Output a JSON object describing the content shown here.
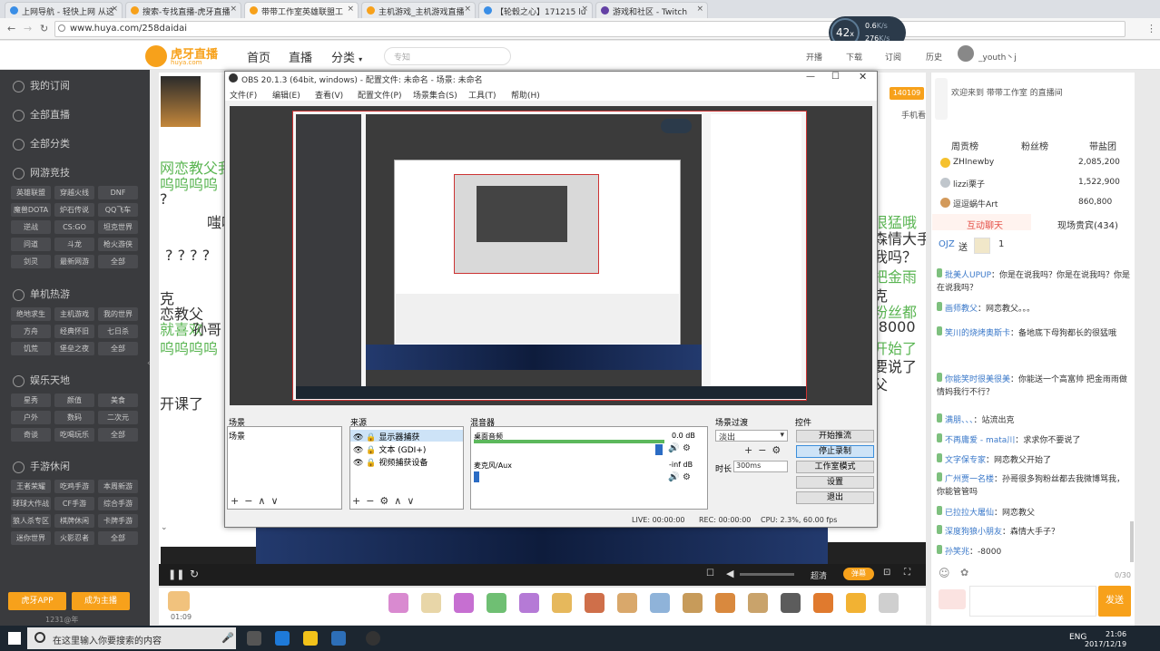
{
  "browser": {
    "tabs": [
      {
        "label": "上网导航 - 轻快上网 从这",
        "color": "#3a8ee6"
      },
      {
        "label": "搜索-专找直播-虎牙直播",
        "color": "#f7a11b"
      },
      {
        "label": "带带工作室英雄联盟工",
        "color": "#f7a11b"
      },
      {
        "label": "主机游戏_主机游戏直播",
        "color": "#f7a11b"
      },
      {
        "label": "【轮毂之心】171215 lu",
        "color": "#3a8ee6"
      },
      {
        "label": "游戏和社区 - Twitch",
        "color": "#6441a5"
      }
    ],
    "url": "www.huya.com/258daidai"
  },
  "perf": {
    "value": "42",
    "unit": "x",
    "up": "0.6",
    "up_unit": "K/s",
    "down": "276",
    "down_unit": "K/s"
  },
  "huya": {
    "logo_main": "虎牙直播",
    "logo_sub": "huya.com",
    "nav": [
      "首页",
      "直播",
      "分类"
    ],
    "search_placeholder": "专知",
    "header_icons": [
      "开播",
      "下载",
      "订阅",
      "历史"
    ],
    "username": "_youth丶j"
  },
  "sidebar": {
    "sections": [
      {
        "title": "我的订阅"
      },
      {
        "title": "全部直播"
      },
      {
        "title": "全部分类"
      },
      {
        "title": "网游竞技",
        "tags": [
          "英雄联盟",
          "穿越火线",
          "DNF",
          "魔兽DOTA",
          "炉石传说",
          "QQ飞车",
          "逆战",
          "CS:GO",
          "坦克世界",
          "问道",
          "斗龙",
          "枪火游侠",
          "剑灵",
          "最新网游",
          "全部"
        ]
      },
      {
        "title": "单机热游",
        "tags": [
          "绝地求生",
          "主机游戏",
          "我的世界",
          "方舟",
          "经典怀旧",
          "七日杀",
          "饥荒",
          "堡垒之夜",
          "全部"
        ]
      },
      {
        "title": "娱乐天地",
        "tags": [
          "星秀",
          "颜值",
          "美食",
          "户外",
          "数码",
          "二次元",
          "奇谈",
          "吃喝玩乐",
          "全部"
        ]
      },
      {
        "title": "手游休闲",
        "tags": [
          "王者荣耀",
          "吃鸡手游",
          "本周新游",
          "球球大作战",
          "CF手游",
          "综合手游",
          "狼人杀专区",
          "棋牌休闲",
          "卡牌手游",
          "迷你世界",
          "火影忍者",
          "全部"
        ]
      }
    ],
    "app_button": "虎牙APP",
    "host_button": "成为主播",
    "year_text": "1231@年"
  },
  "room": {
    "fans_count": "140109",
    "subscribe_label": "订阅",
    "phone_label": "手机看",
    "time": "01:09",
    "quality": "超清",
    "mode": "弹幕"
  },
  "danmu_lines": [
    "网恋教父我",
    "呜呜呜呜",
    "?",
    "嗤嗤",
    "? ? ? ?",
    "克",
    "恋教父",
    "就喜欢",
    "孙哥",
    "呜呜呜呜",
    "开课了",
    "很猛哦",
    "森情大手",
    "我吗？",
    "把金雨",
    "克",
    "粉丝都",
    "-8000",
    "开始了",
    "要说了",
    "父"
  ],
  "obs": {
    "title": "OBS 20.1.3 (64bit, windows) - 配置文件: 未命名 - 场景: 未命名",
    "menu": [
      "文件(F)",
      "编辑(E)",
      "查看(V)",
      "配置文件(P)",
      "场景集合(S)",
      "工具(T)",
      "帮助(H)"
    ],
    "docks": {
      "scenes": {
        "title": "场景",
        "items": [
          "场景"
        ]
      },
      "sources": {
        "title": "来源",
        "items": [
          "显示器捕获",
          "文本 (GDI+)",
          "视频捕获设备"
        ]
      },
      "mixer": {
        "title": "混音器",
        "channels": [
          {
            "name": "桌面音频",
            "db": "0.0 dB"
          },
          {
            "name": "麦克风/Aux",
            "db": "-inf dB"
          }
        ]
      },
      "transitions": {
        "title": "场景过渡",
        "selected": "淡出",
        "duration_label": "时长",
        "duration": "300ms"
      },
      "controls": {
        "title": "控件",
        "buttons": [
          "开始推流",
          "停止录制",
          "工作室模式",
          "设置",
          "退出"
        ]
      }
    },
    "status": {
      "live": "LIVE: 00:00:00",
      "rec": "REC: 00:00:00",
      "cpu": "CPU: 2.3%, 60.00 fps"
    }
  },
  "chat": {
    "welcome": "欢迎来到 带带工作室 的直播间",
    "tabs": [
      "周贡榜",
      "粉丝榜",
      "带盐团"
    ],
    "ranks": [
      {
        "name": "ZHInewby",
        "value": "2,085,200"
      },
      {
        "name": "lizzi栗子",
        "value": "1,522,900"
      },
      {
        "name": "逗逗蜗牛Art",
        "value": "860,800"
      }
    ],
    "sub_tabs": [
      "互动聊天",
      "现场贵宾(434)"
    ],
    "gift_line": {
      "name": "OJZ",
      "action": "送",
      "count": "1"
    },
    "messages": [
      {
        "name": "批美人UPUP",
        "text": "你是在说我吗？你是在说我吗？你是在说我吗？"
      },
      {
        "name": "画师教父",
        "text": "网恋教父。。。"
      },
      {
        "name": "笑川的烧烤奥斯卡",
        "text": "备地底下母狗都长的很猛哦"
      },
      {
        "name": "你能笑时很美很美",
        "text": "你能送一个高富帅 把金雨雨做情妈我行不行？"
      },
      {
        "name": "满朋、、、",
        "text": "站流出克"
      },
      {
        "name": "不再庸爱 - mata川",
        "text": "求求你不要说了"
      },
      {
        "name": "文字保专家",
        "text": "网恋教父开始了"
      },
      {
        "name": "广州贾一名楼",
        "text": "孙哥很多狗粉丝都去我微博骂我，你能管管吗"
      },
      {
        "name": "已拉拉大屠仙",
        "text": "网恋教父"
      },
      {
        "name": "深度狗狼小朋友",
        "text": "森情大手子？"
      },
      {
        "name": "孙笑兆",
        "text": "-8000"
      }
    ],
    "char_count": "0/30",
    "send_label": "发送"
  },
  "taskbar": {
    "search_placeholder": "在这里输入你要搜索的内容",
    "lang": "ENG",
    "time": "21:06",
    "date": "2017/12/19"
  }
}
